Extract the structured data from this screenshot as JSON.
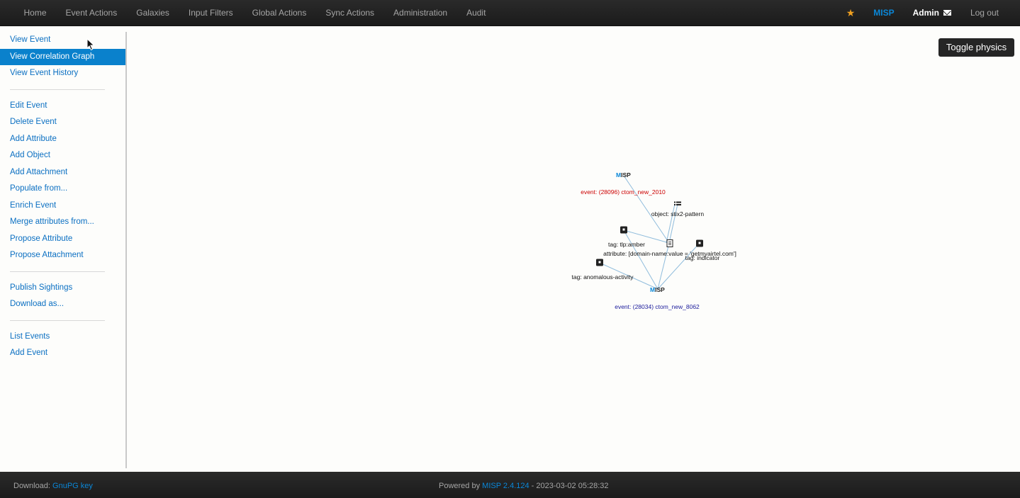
{
  "nav": {
    "items": [
      "Home",
      "Event Actions",
      "Galaxies",
      "Input Filters",
      "Global Actions",
      "Sync Actions",
      "Administration",
      "Audit"
    ],
    "brand": "MISP",
    "user": "Admin",
    "logout": "Log out"
  },
  "sidebar": {
    "group1": [
      "View Event",
      "View Correlation Graph",
      "View Event History"
    ],
    "group2": [
      "Edit Event",
      "Delete Event",
      "Add Attribute",
      "Add Object",
      "Add Attachment",
      "Populate from...",
      "Enrich Event",
      "Merge attributes from...",
      "Propose Attribute",
      "Propose Attachment"
    ],
    "group3": [
      "Publish Sightings",
      "Download as..."
    ],
    "group4": [
      "List Events",
      "Add Event"
    ],
    "active": "View Correlation Graph"
  },
  "toggle_physics": "Toggle physics",
  "graph": {
    "nodes": {
      "event_top": "event: (28096) ctom_new_2010",
      "object": "object: stix2-pattern",
      "tag_tlp": "tag: tlp:amber",
      "attribute": "attribute: [domain-name:value = 'getmyairtel.com']",
      "tag_indicator": "tag: indicator",
      "tag_anomalous": "tag: anomalous-activity",
      "event_bottom": "event: (28034) ctom_new_8062"
    },
    "misp_logo_m": "M",
    "misp_logo_rest": "ISP",
    "colors": {
      "edge": "#8fbcdc",
      "event_top": "#cc0000",
      "event_bottom": "#1c1c9c"
    }
  },
  "footer": {
    "download_label": "Download:",
    "gnupg": "GnuPG key",
    "powered_by": "Powered by",
    "version": "MISP 2.4.124",
    "timestamp": "- 2023-03-02 05:28:32"
  }
}
